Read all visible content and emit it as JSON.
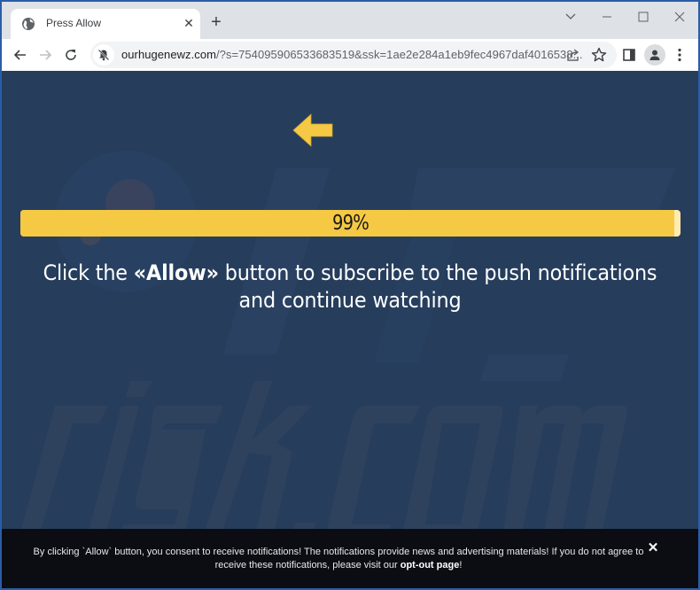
{
  "browser": {
    "tab": {
      "title": "Press Allow",
      "favicon": "globe-icon",
      "close_label": "✕"
    },
    "new_tab_label": "+",
    "window_controls": {
      "tab_search": "chevron-down-icon",
      "minimize": "minimize-icon",
      "maximize": "maximize-icon",
      "close": "close-icon"
    },
    "toolbar": {
      "back": "back-arrow-icon",
      "forward": "forward-arrow-icon",
      "reload": "reload-icon",
      "site_info": "notifications-blocked-icon",
      "url_host": "ourhugenewz.com",
      "url_rest": "/?s=754095906533683519&ssk=1ae2e284a1eb9fec4967daf4016538...",
      "share": "share-icon",
      "bookmark": "star-icon",
      "side_panel": "side-panel-icon",
      "profile": "profile-avatar-icon",
      "menu": "kebab-menu-icon"
    }
  },
  "page": {
    "arrow_icon": "left-arrow-icon",
    "progress": {
      "percent": 99,
      "label": "99%"
    },
    "message": {
      "before": "Click the ",
      "highlight": "«Allow»",
      "after": " button to subscribe to the push notifications and continue watching"
    },
    "watermark_text": "risk.com",
    "consent_banner": {
      "text": "By clicking `Allow` button, you consent to receive notifications! The notifications provide news and advertising materials! If you do not agree to receive these notifications, please visit our ",
      "link_label": "opt-out page",
      "suffix": "!",
      "close_label": "✕"
    }
  },
  "colors": {
    "page_background": "#263d5c",
    "progress_fill": "#f5c944",
    "progress_track": "#fdebb0",
    "arrow": "#f5c944",
    "banner_background": "#0b0d13"
  }
}
